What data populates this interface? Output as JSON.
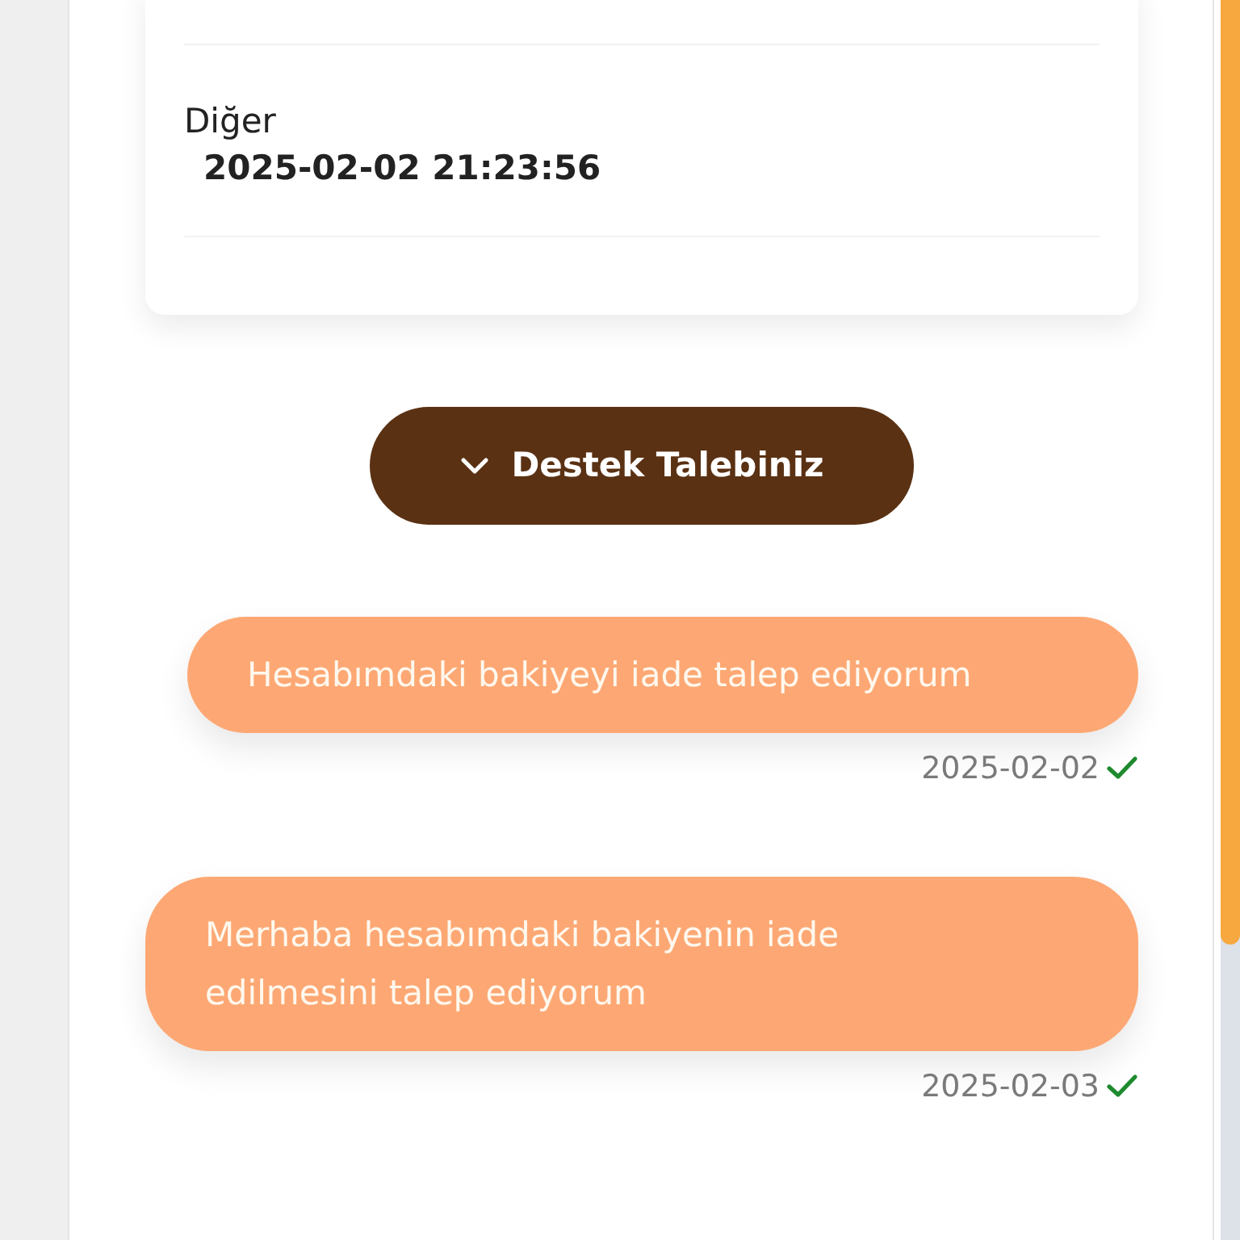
{
  "ticket": {
    "category": "Diğer",
    "datetime": "2025-02-02 21:23:56"
  },
  "toggle_button": {
    "label": "Destek Talebiniz",
    "expanded": true
  },
  "messages": [
    {
      "text": "Hesabımdaki bakiyeyi iade talep ediyorum",
      "date": "2025-02-02",
      "read": true
    },
    {
      "text": "Merhaba hesabımdaki bakiyenin iade edilmesini talep ediyorum",
      "date": "2025-02-03",
      "read": true
    }
  ]
}
